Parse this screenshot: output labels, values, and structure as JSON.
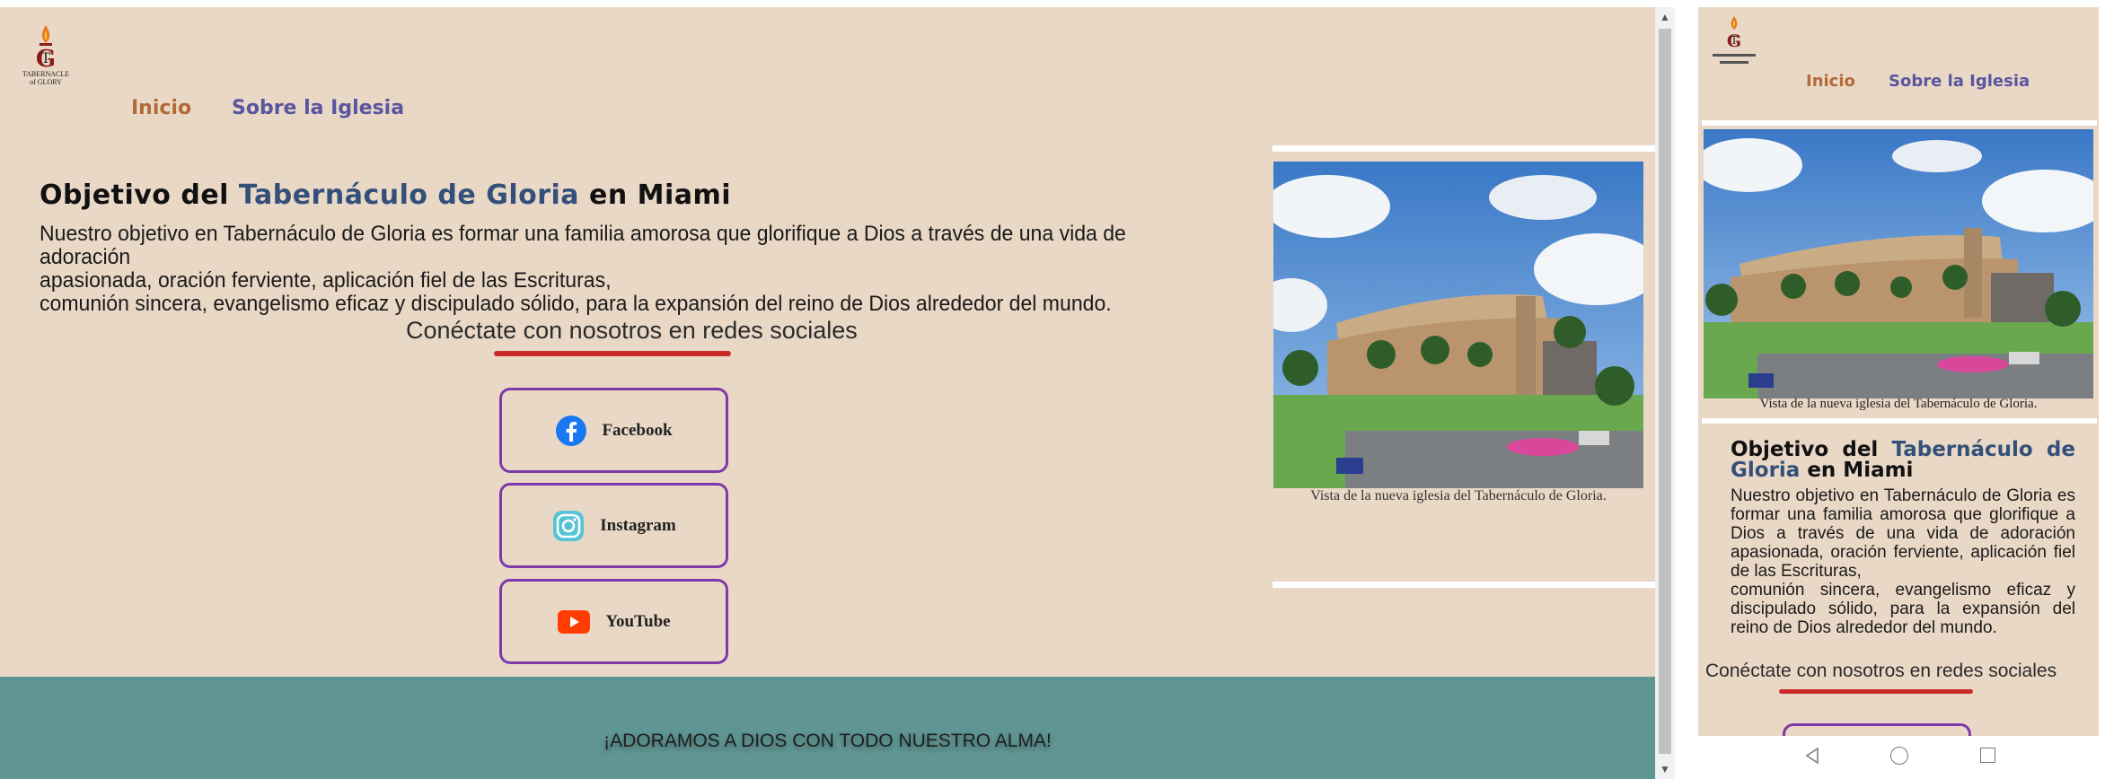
{
  "desktop": {
    "nav": {
      "inicio": "Inicio",
      "sobre": "Sobre la Iglesia"
    },
    "logo": {
      "line1": "TABERNACLE",
      "line2": "of GLORY"
    },
    "title": {
      "prefix": "Objetivo del ",
      "highlight": "Tabernáculo de Gloria",
      "suffix": " en Miami"
    },
    "body": {
      "line1": "Nuestro objetivo en Tabernáculo de Gloria es formar una familia amorosa que glorifique a Dios a través de una vida de adoración",
      "line2": "apasionada, oración ferviente, aplicación fiel de las Escrituras,",
      "line3": "comunión sincera, evangelismo eficaz y discipulado sólido, para la expansión del reino de Dios alrededor del mundo."
    },
    "connect": "Conéctate con nosotros en redes sociales",
    "social": {
      "facebook": "Facebook",
      "instagram": "Instagram",
      "youtube": "YouTube"
    },
    "caption": "Vista de la nueva iglesia del Tabernáculo de Gloria.",
    "footer": "¡ADORAMOS A DIOS CON TODO NUESTRO ALMA!"
  },
  "mobile": {
    "nav": {
      "inicio": "Inicio",
      "sobre": "Sobre la Iglesia"
    },
    "caption": "Vista de la nueva iglesia del Tabernáculo de Gloria.",
    "title": {
      "prefix": "Objetivo del ",
      "highlight": "Tabernáculo de Gloria",
      "suffix": " en Miami"
    },
    "body": {
      "line1": "Nuestro objetivo en Tabernáculo de Gloria es formar una familia amorosa que glorifique a Dios a través de una vida de adoración apasionada, oración ferviente, aplicación fiel de las Escrituras,",
      "line2": "comunión sincera, evangelismo eficaz y discipulado sólido, para la expansión del reino de Dios alrededor del mundo."
    },
    "connect": "Conéctate con nosotros en redes sociales"
  },
  "colors": {
    "background": "#ead8c6",
    "nav_inicio": "#b26a37",
    "nav_sobre": "#5a55a0",
    "title_highlight": "#33507a",
    "button_border": "#7b3aa8",
    "underline": "#cc2a2a",
    "footer": "#5f9593"
  },
  "icons": [
    "facebook-icon",
    "instagram-icon",
    "youtube-icon",
    "back-icon",
    "home-icon",
    "recent-apps-icon"
  ]
}
